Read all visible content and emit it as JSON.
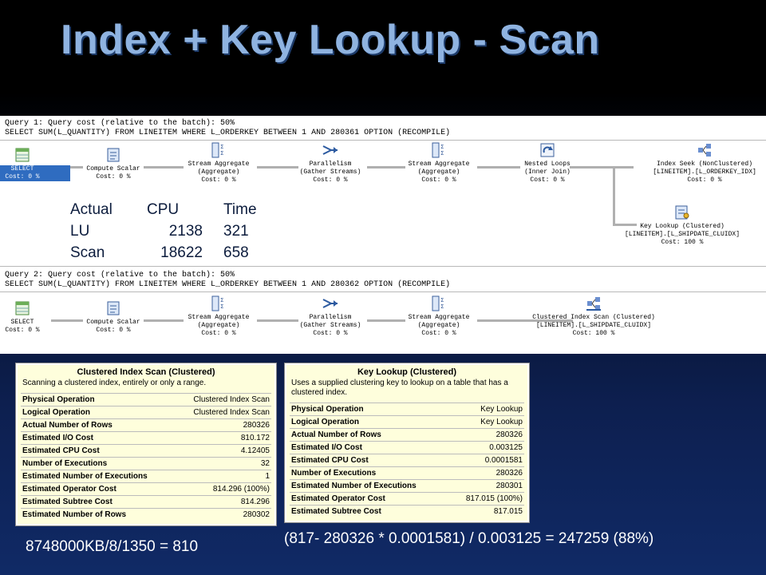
{
  "title": "Index + Key Lookup - Scan",
  "query1": {
    "header": "Query 1: Query cost (relative to the batch): 50%",
    "sql": "SELECT SUM(L_QUANTITY) FROM LINEITEM WHERE L_ORDERKEY BETWEEN 1 AND 280361 OPTION (RECOMPILE)",
    "operators": [
      {
        "name": "SELECT",
        "detail": "",
        "cost": "Cost: 0 %"
      },
      {
        "name": "Compute Scalar",
        "detail": "",
        "cost": "Cost: 0 %"
      },
      {
        "name": "Stream Aggregate",
        "detail": "(Aggregate)",
        "cost": "Cost: 0 %"
      },
      {
        "name": "Parallelism",
        "detail": "(Gather Streams)",
        "cost": "Cost: 0 %"
      },
      {
        "name": "Stream Aggregate",
        "detail": "(Aggregate)",
        "cost": "Cost: 0 %"
      },
      {
        "name": "Nested Loops",
        "detail": "(Inner Join)",
        "cost": "Cost: 0 %"
      },
      {
        "name": "Index Seek (NonClustered)",
        "detail": "[LINEITEM].[L_ORDERKEY_IDX]",
        "cost": "Cost: 0 %"
      },
      {
        "name": "Key Lookup (Clustered)",
        "detail": "[LINEITEM].[L_SHIPDATE_CLUIDX]",
        "cost": "Cost: 100 %"
      }
    ]
  },
  "query2": {
    "header": "Query 2: Query cost (relative to the batch): 50%",
    "sql": "SELECT SUM(L_QUANTITY) FROM LINEITEM WHERE L_ORDERKEY BETWEEN 1 AND 280362 OPTION (RECOMPILE)",
    "operators": [
      {
        "name": "SELECT",
        "detail": "",
        "cost": "Cost: 0 %"
      },
      {
        "name": "Compute Scalar",
        "detail": "",
        "cost": "Cost: 0 %"
      },
      {
        "name": "Stream Aggregate",
        "detail": "(Aggregate)",
        "cost": "Cost: 0 %"
      },
      {
        "name": "Parallelism",
        "detail": "(Gather Streams)",
        "cost": "Cost: 0 %"
      },
      {
        "name": "Stream Aggregate",
        "detail": "(Aggregate)",
        "cost": "Cost: 0 %"
      },
      {
        "name": "Clustered Index Scan (Clustered)",
        "detail": "[LINEITEM].[L_SHIPDATE_CLUIDX]",
        "cost": "Cost: 100 %"
      }
    ]
  },
  "stats": {
    "headers": [
      "Actual",
      "CPU",
      "Time"
    ],
    "rows": [
      [
        "LU",
        "2138",
        "321"
      ],
      [
        "Scan",
        "18622",
        "658"
      ]
    ]
  },
  "tooltip_scan": {
    "title": "Clustered Index Scan (Clustered)",
    "description": "Scanning a clustered index, entirely or only a range.",
    "rows": [
      [
        "Physical Operation",
        "Clustered Index Scan"
      ],
      [
        "Logical Operation",
        "Clustered Index Scan"
      ],
      [
        "Actual Number of Rows",
        "280326"
      ],
      [
        "Estimated I/O Cost",
        "810.172"
      ],
      [
        "Estimated CPU Cost",
        "4.12405"
      ],
      [
        "Number of Executions",
        "32"
      ],
      [
        "Estimated Number of Executions",
        "1"
      ],
      [
        "Estimated Operator Cost",
        "814.296 (100%)"
      ],
      [
        "Estimated Subtree Cost",
        "814.296"
      ],
      [
        "Estimated Number of Rows",
        "280302"
      ]
    ]
  },
  "tooltip_lookup": {
    "title": "Key Lookup (Clustered)",
    "description": "Uses a supplied clustering key to lookup on a table that has a clustered index.",
    "rows": [
      [
        "Physical Operation",
        "Key Lookup"
      ],
      [
        "Logical Operation",
        "Key Lookup"
      ],
      [
        "Actual Number of Rows",
        "280326"
      ],
      [
        "Estimated I/O Cost",
        "0.003125"
      ],
      [
        "Estimated CPU Cost",
        "0.0001581"
      ],
      [
        "Number of Executions",
        "280326"
      ],
      [
        "Estimated Number of Executions",
        "280301"
      ],
      [
        "Estimated Operator Cost",
        "817.015 (100%)"
      ],
      [
        "Estimated Subtree Cost",
        "817.015"
      ]
    ]
  },
  "formula_left": "8748000KB/8/1350 = 810",
  "formula_right": "(817- 280326 * 0.0001581) / 0.003125 = 247259 (88%)",
  "colors": {
    "title": "#8fb3e0",
    "selected": "#2f6cc0",
    "tooltip_bg": "#fefedc"
  }
}
